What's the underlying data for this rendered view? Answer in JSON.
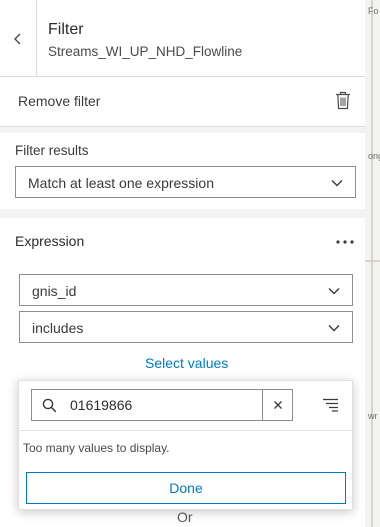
{
  "header": {
    "title": "Filter",
    "subtitle": "Streams_WI_UP_NHD_Flowline"
  },
  "remove_filter": {
    "label": "Remove filter",
    "icon": "trash-icon"
  },
  "filter_results": {
    "label": "Filter results",
    "selected": "Match at least one expression"
  },
  "expression": {
    "label": "Expression",
    "field_selected": "gnis_id",
    "operator_selected": "includes",
    "select_values_link": "Select values"
  },
  "value_picker": {
    "search_value": "01619866",
    "message": "Too many values to display.",
    "done_label": "Done"
  },
  "footer": {
    "or_label": "Or"
  },
  "map": {
    "labels": [
      "Fo",
      "ong",
      "wr"
    ]
  },
  "colors": {
    "accent": "#007ac2",
    "panel_bg": "#f3f3f3",
    "border": "#8e8e8e"
  }
}
